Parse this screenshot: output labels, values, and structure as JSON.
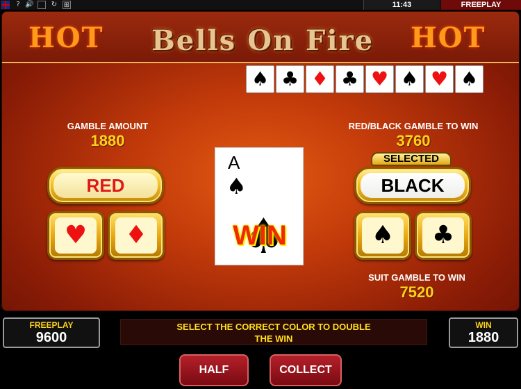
{
  "system_bar": {
    "time": "11:43",
    "mode": "FREEPLAY",
    "icons": [
      "uk-flag-icon",
      "help-icon",
      "sound-icon",
      "fullscreen-icon",
      "reload-icon",
      "settings-icon"
    ]
  },
  "header": {
    "title": "Bells On Fire",
    "hot_left": "HOT",
    "hot_right": "HOT"
  },
  "history": [
    {
      "suit": "♠",
      "color": "black"
    },
    {
      "suit": "♣",
      "color": "black"
    },
    {
      "suit": "♦",
      "color": "red"
    },
    {
      "suit": "♣",
      "color": "black"
    },
    {
      "suit": "♥",
      "color": "red"
    },
    {
      "suit": "♠",
      "color": "black"
    },
    {
      "suit": "♥",
      "color": "red"
    },
    {
      "suit": "♠",
      "color": "black"
    }
  ],
  "gamble": {
    "amount_label": "GAMBLE AMOUNT",
    "amount_value": "1880",
    "color_label": "RED/BLACK GAMBLE TO WIN",
    "color_value": "3760",
    "suit_label": "SUIT GAMBLE TO WIN",
    "suit_value": "7520"
  },
  "buttons": {
    "red": "RED",
    "black": "BLACK",
    "selected_tag": "SELECTED",
    "heart": "♥",
    "diamond": "♦",
    "spade": "♠",
    "club": "♣",
    "half": "HALF",
    "collect": "COLLECT"
  },
  "card": {
    "rank": "A",
    "suit": "♠",
    "result": "WIN"
  },
  "footer": {
    "freeplay_label": "FREEPLAY",
    "freeplay_value": "9600",
    "win_label": "WIN",
    "win_value": "1880",
    "message_line1": "SELECT THE CORRECT COLOR TO DOUBLE",
    "message_line2": "THE WIN"
  },
  "colors": {
    "gold_text": "#ffd21a",
    "red_suit": "#e11111",
    "panel_orange": "#c23a0a"
  }
}
